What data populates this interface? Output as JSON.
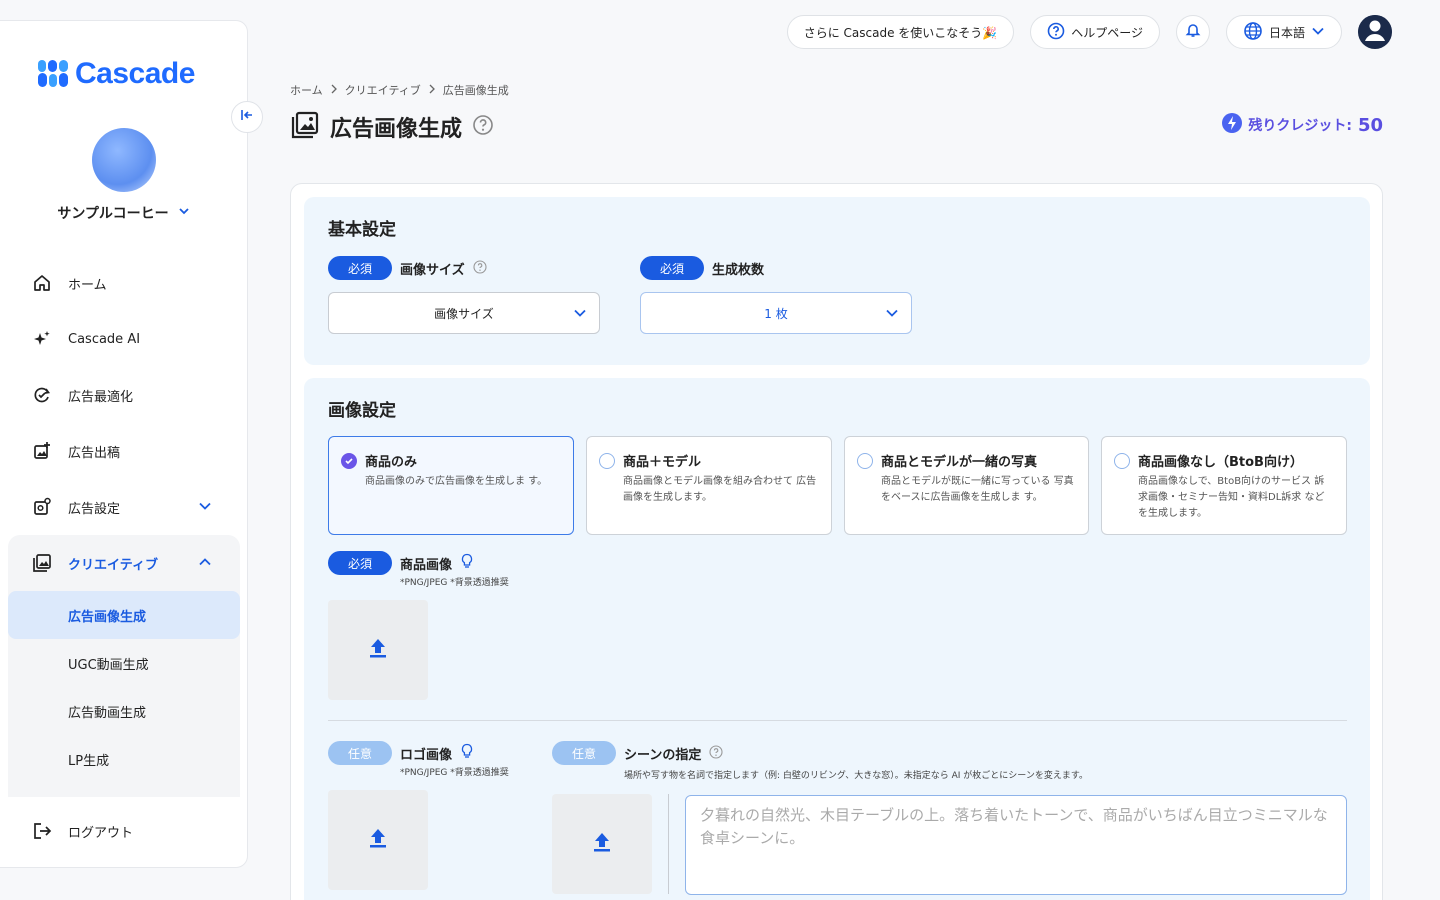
{
  "brand": {
    "name": "Cascade",
    "color": "#1f6bff"
  },
  "sidebar": {
    "company": "サンプルコーヒー",
    "items": [
      {
        "label": "ホーム",
        "icon": "home-icon"
      },
      {
        "label": "Cascade AI",
        "icon": "sparkle-icon"
      },
      {
        "label": "広告最適化",
        "icon": "optimize-icon"
      },
      {
        "label": "広告出稿",
        "icon": "publish-icon"
      },
      {
        "label": "広告設定",
        "icon": "settings-image-icon"
      }
    ],
    "group": {
      "label": "クリエイティブ",
      "icon": "gallery-icon",
      "sub": [
        "広告画像生成",
        "UGC動画生成",
        "広告動画生成",
        "LP生成"
      ]
    },
    "logout": "ログアウト"
  },
  "topbar": {
    "promo": "さらに Cascade を使いこなそう🎉",
    "help": "ヘルプページ",
    "language": "日本語"
  },
  "breadcrumb": [
    "ホーム",
    "クリエイティブ",
    "広告画像生成"
  ],
  "page": {
    "title": "広告画像生成",
    "credits_label": "残りクレジット:",
    "credits_value": "50"
  },
  "basic": {
    "title": "基本設定",
    "required": "必須",
    "size_label": "画像サイズ",
    "size_value": "画像サイズ",
    "count_label": "生成枚数",
    "count_value": "1 枚"
  },
  "image_settings": {
    "title": "画像設定",
    "options": [
      {
        "title": "商品のみ",
        "desc": "商品画像のみで広告画像を生成しま す。",
        "selected": true
      },
      {
        "title": "商品＋モデル",
        "desc": "商品画像とモデル画像を組み合わせて 広告画像を生成します。",
        "selected": false
      },
      {
        "title": "商品とモデルが一緒の写真",
        "desc": "商品とモデルが既に一緒に写っている 写真をベースに広告画像を生成しま す。",
        "selected": false
      },
      {
        "title": "商品画像なし（BtoB向け）",
        "desc": "商品画像なしで、BtoB向けのサービス 訴求画像・セミナー告知・資料DL訴求 などを生成します。",
        "selected": false
      }
    ],
    "required": "必須",
    "optional": "任意",
    "product_label": "商品画像",
    "product_note": "*PNG/JPEG *背景透過推奨",
    "logo_label": "ロゴ画像",
    "logo_note": "*PNG/JPEG *背景透過推奨",
    "scene_label": "シーンの指定",
    "scene_note": "場所や写す物を名詞で指定します（例: 白壁のリビング、大きな窓）。未指定なら AI が枚ごとにシーンを変えます。",
    "scene_placeholder": "夕暮れの自然光、木目テーブルの上。落ち着いたトーンで、商品がいちばん目立つミニマルな食卓シーンに。"
  }
}
